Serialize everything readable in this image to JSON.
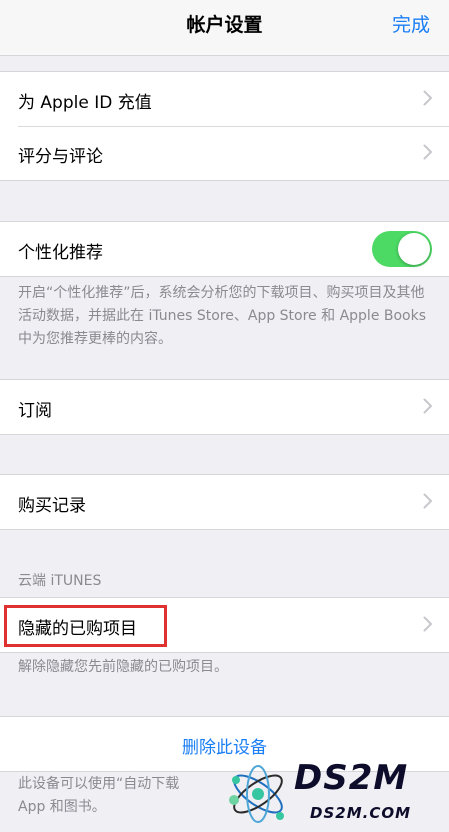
{
  "nav": {
    "title": "帐户设置",
    "done_label": "完成"
  },
  "group1": [
    {
      "label": "为 Apple ID 充值"
    },
    {
      "label": "评分与评论"
    }
  ],
  "personalization": {
    "label": "个性化推荐",
    "toggle_on": true,
    "footer": "开启“个性化推荐”后，系统会分析您的下载项目、购买项目及其他活动数据，并据此在 iTunes Store、App Store 和 Apple Books 中为您推荐更棒的内容。"
  },
  "subscriptions": {
    "label": "订阅"
  },
  "purchase_history": {
    "label": "购买记录"
  },
  "itunes_cloud": {
    "header": "云端 iTUNES",
    "hidden_purchases_label": "隐藏的已购项目",
    "footer": "解除隐藏您先前隐藏的已购项目。"
  },
  "device": {
    "remove_label": "删除此设备",
    "footer_line1": "此设备可以使用“自动下载",
    "footer_line2": "App 和图书。"
  },
  "watermark": {
    "brand": "DS2M",
    "site": "DS2M.COM"
  },
  "colors": {
    "accent": "#1a7ef5",
    "toggle_on": "#4cd964",
    "highlight": "#e03131"
  }
}
